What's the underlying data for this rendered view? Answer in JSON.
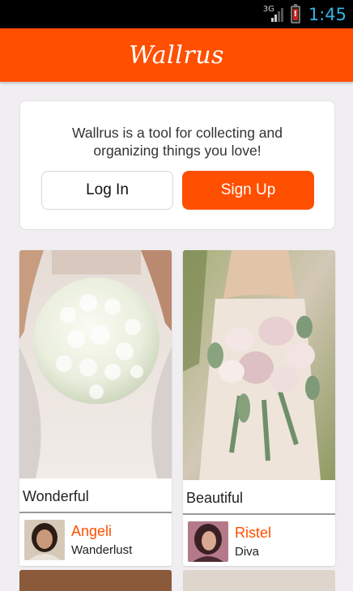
{
  "status_bar": {
    "network": "3G",
    "time": "1:45",
    "battery_alert": "!"
  },
  "app_bar": {
    "title": "Wallrus"
  },
  "intro": {
    "line1": "Wallrus is a tool for collecting and",
    "line2": "organizing things you love!",
    "login_label": "Log In",
    "signup_label": "Sign Up"
  },
  "pins": [
    {
      "caption": "Wonderful",
      "user_name": "Angeli",
      "board": "Wanderlust"
    },
    {
      "caption": "Beautiful",
      "user_name": "Ristel",
      "board": "Diva"
    }
  ],
  "colors": {
    "brand": "#ff4f00",
    "clock": "#33b5e5"
  }
}
